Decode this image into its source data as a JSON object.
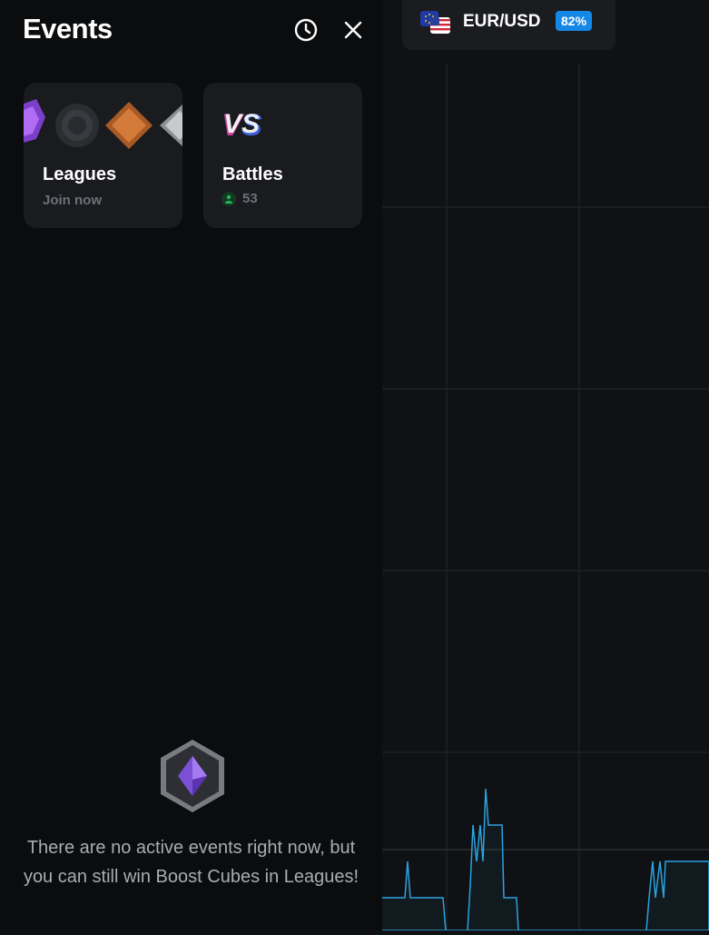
{
  "panel": {
    "title": "Events",
    "history_icon": "clock-icon",
    "close_icon": "close-icon"
  },
  "cards": {
    "leagues": {
      "title": "Leagues",
      "subtitle": "Join now"
    },
    "battles": {
      "title": "Battles",
      "participants": "53"
    }
  },
  "empty_state": {
    "icon": "league-crystal-icon",
    "message": "There are no active events right now, but you can still win Boost Cubes in Leagues!"
  },
  "asset": {
    "pair": "EUR/USD",
    "payout": "82%"
  },
  "colors": {
    "accent_blue": "#1488e6",
    "online_green": "#1fb85a",
    "chart_line": "#2aa2e0"
  }
}
